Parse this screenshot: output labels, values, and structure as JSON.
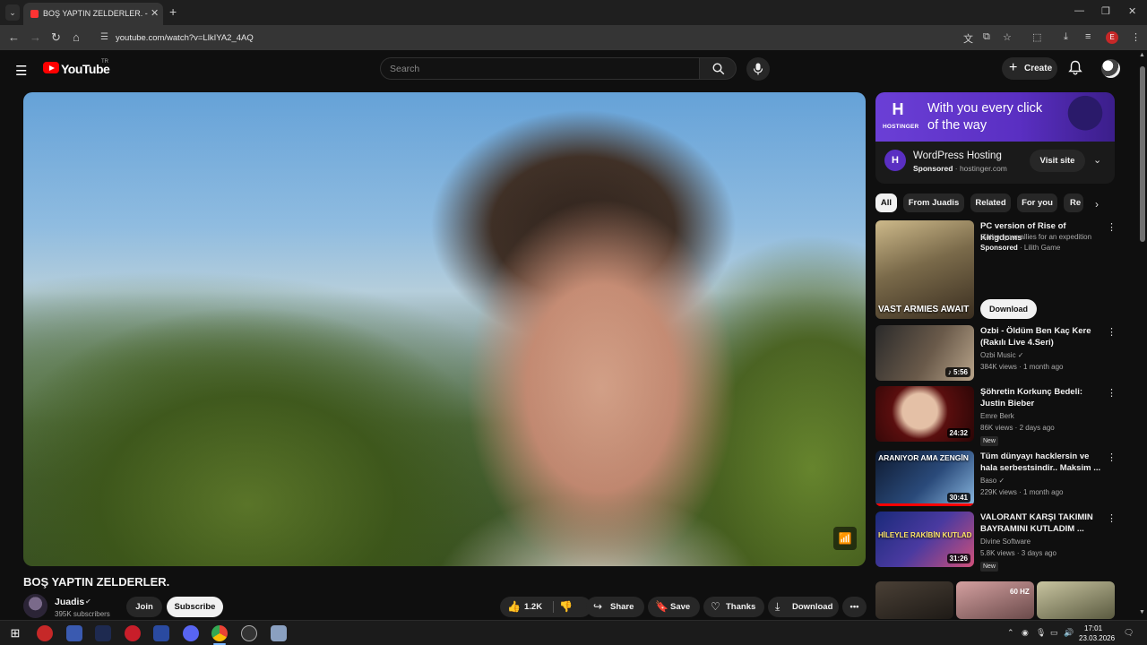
{
  "browser": {
    "tab_title": "BOŞ YAPTIN ZELDERLER. - Y",
    "tab_close": "✕",
    "new_tab": "+",
    "url": "youtube.com/watch?v=LlkIYA2_4AQ",
    "window_controls": [
      "—",
      "❐",
      "✕"
    ],
    "profile_initial": "E"
  },
  "youtube": {
    "wordmark": "YouTube",
    "country": "TR",
    "search_placeholder": "Search",
    "create_label": "Create"
  },
  "video": {
    "title": "BOŞ YAPTIN ZELDERLER.",
    "channel_name": "Juadis",
    "subscribers": "395K subscribers",
    "join_label": "Join",
    "subscribe_label": "Subscribe",
    "likes": "1.2K",
    "share_label": "Share",
    "save_label": "Save",
    "thanks_label": "Thanks",
    "download_label": "Download",
    "more_label": "•••"
  },
  "ad": {
    "brand_word": "HOSTINGER",
    "headline": "With you every click of the way",
    "title": "WordPress Hosting",
    "sponsored_label": "Sponsored",
    "domain": " · hostinger.com",
    "visit_label": "Visit site"
  },
  "chips": [
    "All",
    "From Juadis",
    "Related",
    "For you",
    "Re"
  ],
  "recommendations": [
    {
      "title": "PC version of Rise of Kingdoms",
      "sub": "Gather your allies for an expedition",
      "sponsored": "Sponsored",
      "meta": " · Lilith Game",
      "caption": "VAST ARMIES AWAIT",
      "button": "Download",
      "color_a": "#7a6a4a",
      "color_b": "#c9b07a"
    },
    {
      "title": "Ozbi - Öldüm Ben Kaç Kere (Rakılı Live 4.Seri)",
      "sub": "Ozbi Music ✓",
      "meta": "384K views · 1 month ago",
      "duration": "♪ 5:56",
      "color_a": "#3a3a3a",
      "color_b": "#8a7a6a"
    },
    {
      "title": "Şöhretin Korkunç Bedeli: Justin Bieber",
      "sub": "Emre Berk",
      "meta": "86K views · 2 days ago",
      "duration": "24:32",
      "badge": "New",
      "color_a": "#4a0a0a",
      "color_b": "#c8a48a"
    },
    {
      "title": "Tüm dünyayı hacklersin ve hala serbestsindir.. Maksim ...",
      "sub": "Baso ✓",
      "meta": "229K views · 1 month ago",
      "duration": "30:41",
      "caption": "ARANIYOR AMA ZENGİN",
      "color_a": "#1a2a4a",
      "color_b": "#7ab0e0"
    },
    {
      "title": "VALORANT KARŞI TAKIMIN BAYRAMINI KUTLADIM ...",
      "sub": "Divine Software",
      "meta": "5.8K views · 3 days ago",
      "duration": "31:26",
      "badge": "New",
      "caption": "HİLEYLE RAKİBİN KUTLAD",
      "color_a": "#2a3a8a",
      "color_b": "#e05a8a"
    }
  ],
  "shorts": {
    "label": "60 HZ"
  },
  "taskbar": {
    "time": "17:01",
    "date": "23.03.2026"
  },
  "colors": {
    "youtube_red": "#ff0000",
    "hostinger_purple": "#6b3fd6",
    "background": "#0f0f0f"
  }
}
